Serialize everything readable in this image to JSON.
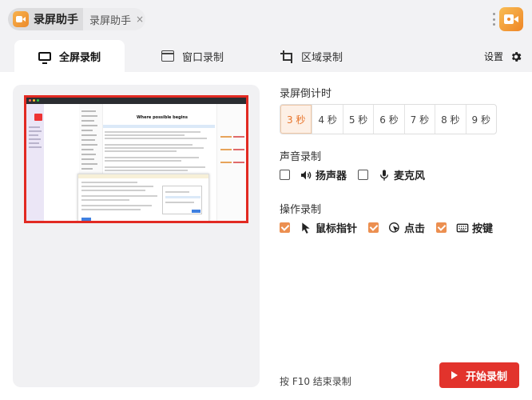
{
  "titlebar": {
    "tabs": [
      {
        "label": "录屏助手",
        "active": true
      },
      {
        "label": "录屏助手",
        "active": false
      }
    ],
    "close_glyph": "×"
  },
  "modes": [
    {
      "label": "全屏录制",
      "icon": "monitor-icon",
      "active": true
    },
    {
      "label": "窗口录制",
      "icon": "window-icon",
      "active": false
    },
    {
      "label": "区域录制",
      "icon": "crop-icon",
      "active": false
    }
  ],
  "settings_label": "设置",
  "preview": {
    "doc_title": "Where possible begins"
  },
  "countdown": {
    "label": "录屏倒计时",
    "options": [
      "3 秒",
      "4 秒",
      "5 秒",
      "6 秒",
      "7 秒",
      "8 秒",
      "9 秒"
    ],
    "selected_index": 0
  },
  "audio": {
    "label": "声音录制",
    "options": [
      {
        "label": "扬声器",
        "icon": "speaker-icon",
        "checked": false
      },
      {
        "label": "麦克风",
        "icon": "microphone-icon",
        "checked": false
      }
    ]
  },
  "actions": {
    "label": "操作录制",
    "options": [
      {
        "label": "鼠标指针",
        "icon": "cursor-icon",
        "checked": true
      },
      {
        "label": "点击",
        "icon": "click-icon",
        "checked": true
      },
      {
        "label": "按键",
        "icon": "keyboard-icon",
        "checked": true
      }
    ]
  },
  "footer": {
    "hint": "按 F10 结束录制",
    "start_label": "开始录制"
  },
  "colors": {
    "accent": "#e8742a",
    "start_button": "#e2332c",
    "preview_border": "#e22a22"
  }
}
